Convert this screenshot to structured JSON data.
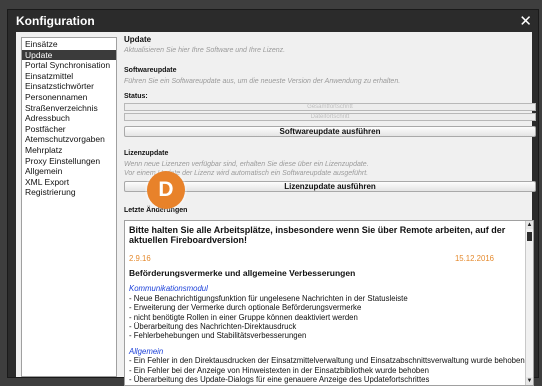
{
  "window": {
    "title": "Konfiguration",
    "close_glyph": "✕"
  },
  "sidebar": {
    "items": [
      "Einsätze",
      "Update",
      "Portal Synchronisation",
      "Einsatzmittel",
      "Einsatzstichwörter",
      "Personennamen",
      "Straßenverzeichnis",
      "Adressbuch",
      "Postfächer",
      "Atemschutzvorgaben",
      "Mehrplatz",
      "Proxy Einstellungen",
      "Allgemein",
      "XML Export",
      "Registrierung"
    ],
    "selected": "Update"
  },
  "update": {
    "heading": "Update",
    "subtitle": "Aktualisieren Sie hier Ihre Software und Ihre Lizenz.",
    "software": {
      "heading": "Softwareupdate",
      "desc": "Führen Sie ein Softwareupdate aus, um die neueste Version der Anwendung zu erhalten.",
      "status_label": "Status:",
      "progress_overall": "Gesamtfortschritt",
      "progress_file": "Dateifortschritt",
      "button": "Softwareupdate ausführen"
    },
    "license": {
      "heading": "Lizenzupdate",
      "desc1": "Wenn neue Lizenzen verfügbar sind, erhalten Sie diese über ein Lizenzupdate.",
      "desc2": "Vor einem Update der Lizenz wird automatisch ein Softwareupdate ausgeführt.",
      "button": "Lizenzupdate ausführen"
    },
    "changes": {
      "heading": "Letzte Änderungen",
      "notice": "Bitte halten Sie alle Arbeitsplätze, insbesondere wenn Sie über Remote arbeiten, auf der aktuellen Fireboardversion!",
      "version": "2.9.16",
      "date": "15.12.2016",
      "title": "Beförderungsvermerke und allgemeine Verbesserungen",
      "section1": "Kommunikationsmodul",
      "items1": [
        "- Neue Benachrichtigungsfunktion für ungelesene Nachrichten in der Statusleiste",
        "- Erweiterung der Vermerke durch optionale Beförderungsvermerke",
        "- nicht benötigte Rollen in einer Gruppe können deaktiviert werden",
        "- Überarbeitung des Nachrichten-Direktausdruck",
        "- Fehlerbehebungen und Stabilitätsverbesserungen"
      ],
      "section2": "Allgemein",
      "items2": [
        "- Ein Fehler in den Direktausdrucken der Einsatzmittelverwaltung und Einsatzabschnittsverwaltung wurde behoben",
        "- Ein Fehler bei der Anzeige von Hinweistexten in der Einsatzbibliothek wurde behoben",
        "- Überarbeitung des Update-Dialogs für eine genauere Anzeige des Updatefortschrittes"
      ]
    }
  },
  "badge": {
    "letter": "D",
    "color": "#e8822a"
  }
}
